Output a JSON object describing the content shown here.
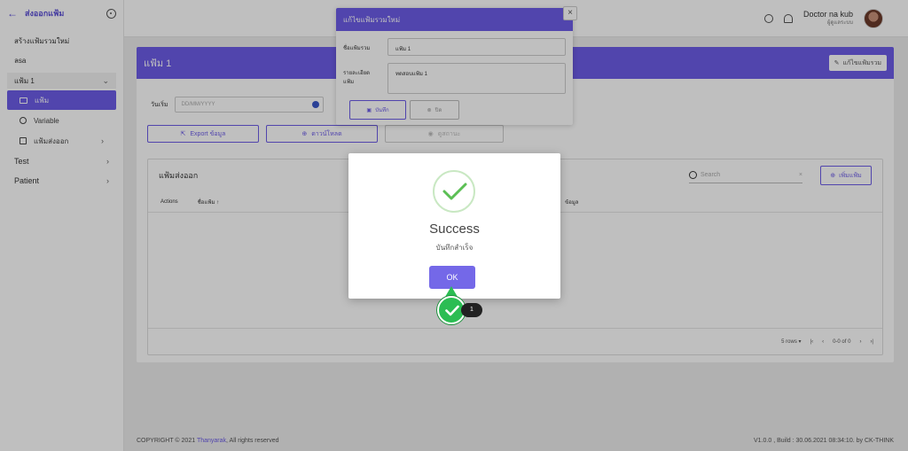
{
  "sidebar": {
    "title": "ส่งออกแฟ้ม",
    "links": [
      "สร้างแฟ้มรวมใหม่",
      "ลsa"
    ],
    "group_label": "แฟ้ม 1",
    "subitems": [
      {
        "label": "แฟ้ม",
        "icon": "folder-icon",
        "active": true
      },
      {
        "label": "Variable",
        "icon": "circle-icon",
        "active": false
      },
      {
        "label": "แฟ้มส่งออก",
        "icon": "external-icon",
        "active": false
      }
    ],
    "items": [
      {
        "label": "Test"
      },
      {
        "label": "Patient"
      }
    ]
  },
  "topbar": {
    "user_name": "Doctor na kub",
    "user_role": "ผู้ดูแลระบบ"
  },
  "main": {
    "title": "แฟ้ม 1",
    "edit_group_label": "แก้ไขแฟ้มรวม",
    "date_label": "วันเริ่ม",
    "date_placeholder": "DD/MM/YYYY",
    "export_label": "Export ข้อมูล",
    "download_label": "ดาวน์โหลด",
    "view_label": "ดูสถานะ",
    "table_title": "แฟ้มส่งออก",
    "search_placeholder": "Search",
    "add_label": "เพิ่มแฟ้ม",
    "col_actions": "Actions",
    "col_name": "ชื่อแฟ้ม",
    "col_data": "ข้อมูล",
    "rows_label": "5 rows",
    "page_label": "0-0 of 0"
  },
  "edit_modal": {
    "title": "แก้ไขแฟ้มรวมใหม่",
    "name_label": "ชื่อแฟ้มรวม",
    "name_value": "แฟ้ม 1",
    "desc_label": "รายละเอียดแฟ้ม",
    "desc_value": "ทดสอบแฟ้ม 1",
    "save_label": "บันทึก",
    "cancel_label": "ปิด"
  },
  "success_dialog": {
    "title": "Success",
    "message": "บันทึกสำเร็จ",
    "ok_label": "OK"
  },
  "step_marker": {
    "number": "1"
  },
  "footer": {
    "copyright": "COPYRIGHT © 2021",
    "brand": "Thanyarak",
    "rights": ", All rights reserved",
    "version": "V1.0.0 , Build : 30.06.2021 08:34:10. by CK-THINK"
  },
  "colors": {
    "accent": "#6c5ce7",
    "success": "#2bbd53"
  }
}
